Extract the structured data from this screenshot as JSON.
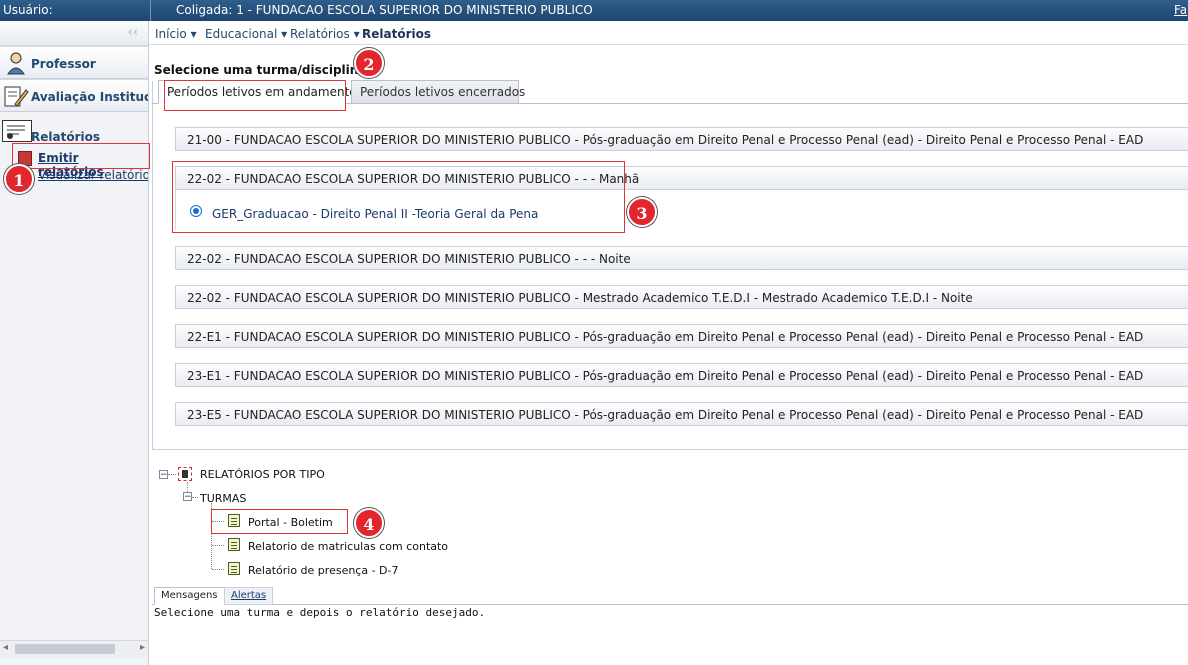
{
  "topbar": {
    "user_label": "Usuário:",
    "coligada": "Coligada: 1 - FUNDACAO ESCOLA SUPERIOR DO MINISTERIO PUBLICO",
    "right_link": "Fa"
  },
  "sidebar": {
    "collapse_glyph": "‹‹",
    "modules": [
      {
        "label": "Professor",
        "icon": "professor-icon"
      },
      {
        "label": "Avaliação Institucional",
        "icon": "pencil-doc-icon"
      }
    ],
    "reports_label": "Relatórios",
    "reports_items": [
      "Emitir relatórios",
      "Visualizar relatórios"
    ]
  },
  "menu": {
    "items": [
      "Início",
      "Educacional",
      "Relatórios"
    ],
    "current": "Relatórios"
  },
  "main": {
    "prompt": "Selecione uma turma/disciplina:",
    "tabs": [
      "Períodos letivos em andamento",
      "Períodos letivos encerrados"
    ],
    "periods": [
      "21-00 - FUNDACAO ESCOLA SUPERIOR DO MINISTERIO PUBLICO - Pós-graduação em Direito Penal e Processo Penal (ead) - Direito Penal e Processo Penal - EAD",
      "22-02 - FUNDACAO ESCOLA SUPERIOR DO MINISTERIO PUBLICO -  -  - Manhã",
      "22-02 - FUNDACAO ESCOLA SUPERIOR DO MINISTERIO PUBLICO -  -  - Noite",
      "22-02 - FUNDACAO ESCOLA SUPERIOR DO MINISTERIO PUBLICO - Mestrado Academico T.E.D.I - Mestrado Academico T.E.D.I - Noite",
      "22-E1 - FUNDACAO ESCOLA SUPERIOR DO MINISTERIO PUBLICO - Pós-graduação em Direito Penal e Processo Penal (ead) - Direito Penal e Processo Penal - EAD",
      "23-E1 - FUNDACAO ESCOLA SUPERIOR DO MINISTERIO PUBLICO - Pós-graduação em Direito Penal e Processo Penal (ead) - Direito Penal e Processo Penal - EAD",
      "23-E5 - FUNDACAO ESCOLA SUPERIOR DO MINISTERIO PUBLICO - Pós-graduação em Direito Penal e Processo Penal (ead) - Direito Penal e Processo Penal - EAD"
    ],
    "selected_discipline": "GER_Graduacao - Direito Penal II -Teoria Geral da Pena"
  },
  "tree": {
    "root": "RELATÓRIOS POR TIPO",
    "group": "TURMAS",
    "reports": [
      "Portal - Boletim",
      "Relatorio de matriculas com contato",
      "Relatório de presença - D-7"
    ]
  },
  "messages": {
    "tabs": [
      "Mensagens",
      "Alertas"
    ],
    "text": "Selecione uma turma e depois o relatório desejado."
  },
  "annotations": [
    "1",
    "2",
    "3",
    "4"
  ],
  "colors": {
    "accent_red": "#e1262e",
    "topbar": "#2f5f8c",
    "link": "#1a3a6b"
  }
}
